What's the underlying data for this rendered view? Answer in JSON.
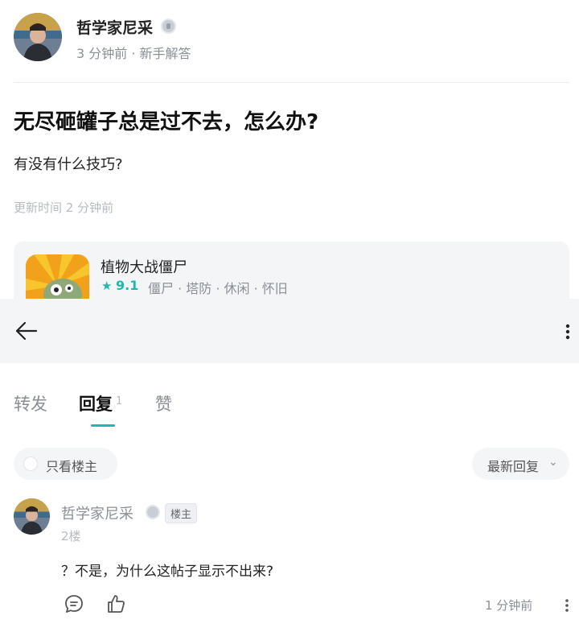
{
  "post": {
    "author": "哲学家尼采",
    "meta": "3 分钟前 · 新手解答",
    "title": "无尽砸罐子总是过不去，怎么办?",
    "body": "有没有什么技巧?",
    "updated": "更新时间 2 分钟前"
  },
  "game": {
    "name": "植物大战僵尸",
    "rating": "9.1",
    "tags": "僵尸 · 塔防 · 休闲 · 怀旧"
  },
  "tabs": [
    {
      "label": "转发"
    },
    {
      "label": "回复",
      "count": "1"
    },
    {
      "label": "赞"
    }
  ],
  "filters": {
    "only_op": "只看楼主",
    "sort": "最新回复"
  },
  "reply": {
    "author": "哲学家尼采",
    "op_badge": "楼主",
    "floor": "2楼",
    "text": "？不是，为什么这帖子显示不出来?",
    "time": "1 分钟前"
  },
  "colors": {
    "accent": "#1fb8b0",
    "muted": "#8a8f96",
    "panel": "#f4f5f7"
  }
}
